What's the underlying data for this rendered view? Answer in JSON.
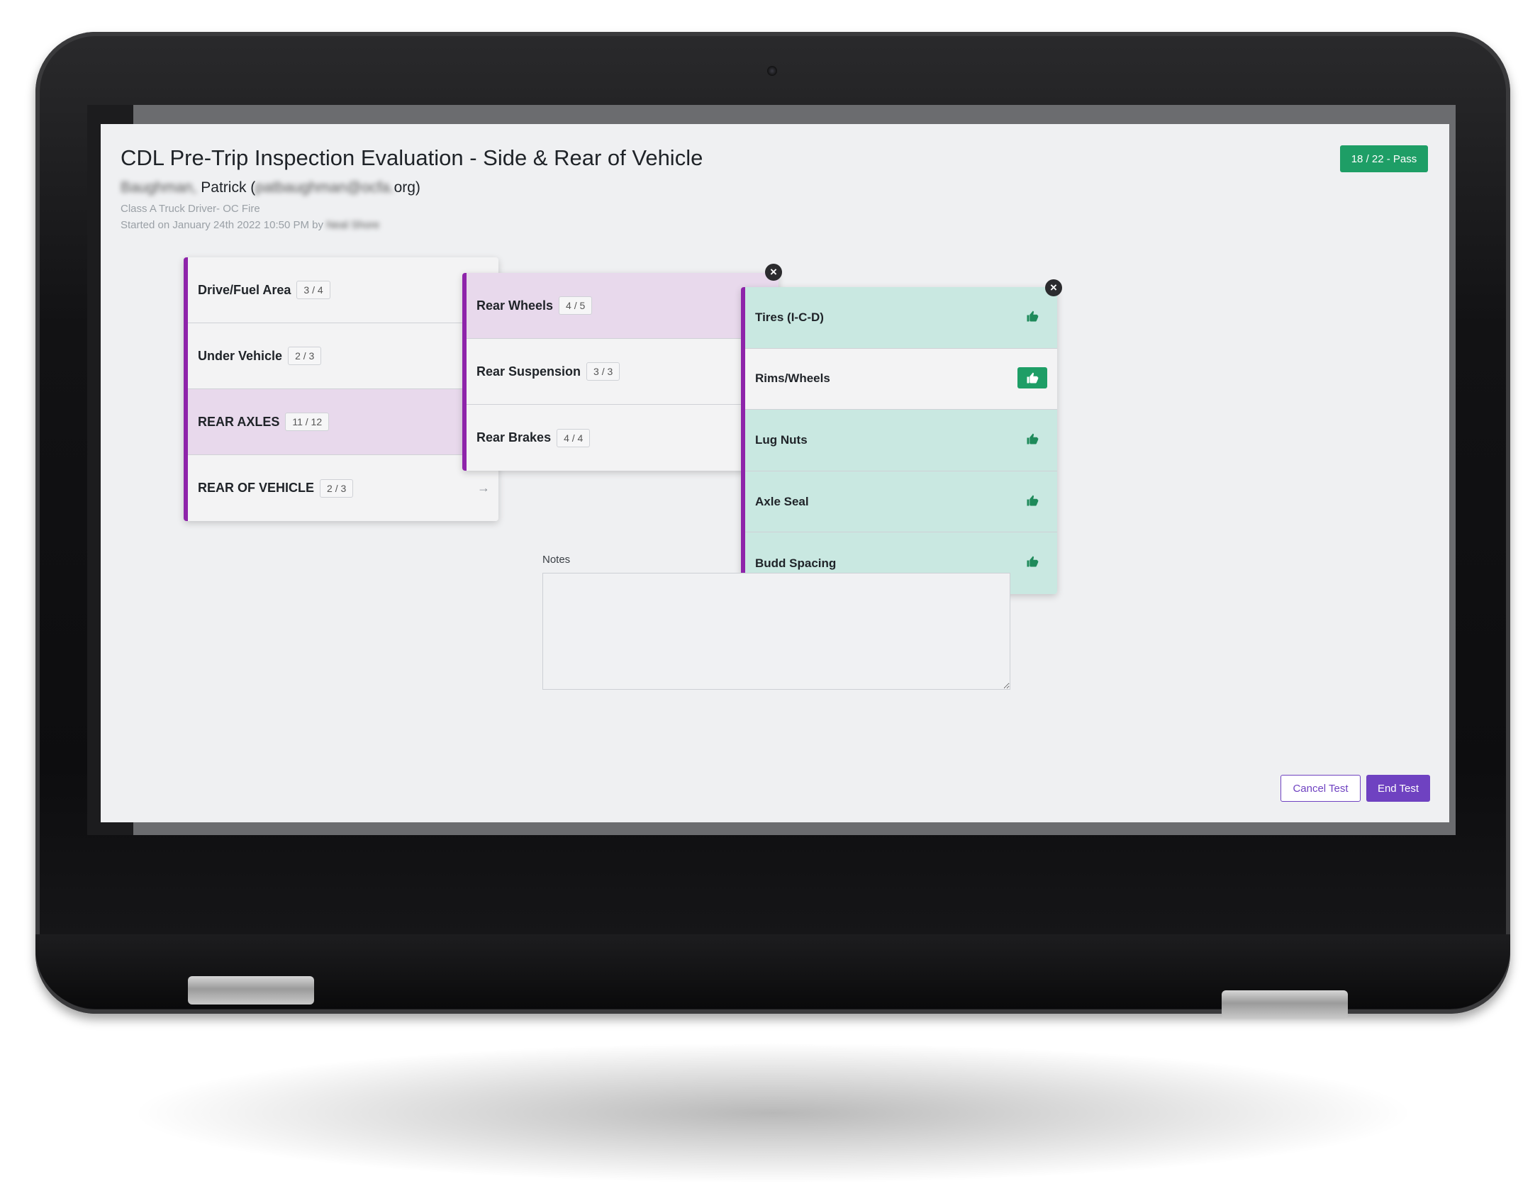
{
  "header": {
    "title": "CDL Pre-Trip Inspection Evaluation - Side & Rear of Vehicle",
    "user_last_name": "Baughman,",
    "user_first_name": "Patrick (",
    "user_email": "patbaughman@ocfa.",
    "user_email_tail": "org)",
    "role": "Class A Truck Driver- OC Fire",
    "started_prefix": "Started on January 24th 2022 10:50 PM by",
    "started_by": "Neal Shore",
    "score_badge": "18 / 22 - Pass"
  },
  "sections": [
    {
      "label": "Drive/Fuel Area",
      "count": "3 / 4"
    },
    {
      "label": "Under Vehicle",
      "count": "2 / 3"
    },
    {
      "label": "REAR AXLES",
      "count": "11 / 12",
      "selected": true
    },
    {
      "label": "REAR OF VEHICLE",
      "count": "2 / 3"
    }
  ],
  "subsections": [
    {
      "label": "Rear Wheels",
      "count": "4 / 5",
      "selected": true
    },
    {
      "label": "Rear Suspension",
      "count": "3 / 3"
    },
    {
      "label": "Rear Brakes",
      "count": "4 / 4"
    }
  ],
  "items": [
    {
      "label": "Tires (I-C-D)",
      "status": "pass"
    },
    {
      "label": "Rims/Wheels",
      "status": "selected"
    },
    {
      "label": "Lug Nuts",
      "status": "pass"
    },
    {
      "label": "Axle Seal",
      "status": "pass"
    },
    {
      "label": "Budd Spacing",
      "status": "pass"
    }
  ],
  "notes": {
    "label": "Notes",
    "value": ""
  },
  "footer": {
    "cancel_label": "Cancel Test",
    "end_label": "End Test"
  },
  "icons": {
    "close": "close-icon",
    "thumb": "thumbs-up-icon",
    "arrow": "arrow-right-icon"
  },
  "colors": {
    "accent": "#8e24aa",
    "pass": "#1e9e66",
    "primary_button": "#6f42c1",
    "selected_row": "#e8d9ec",
    "pass_row": "#c9e8e1"
  }
}
